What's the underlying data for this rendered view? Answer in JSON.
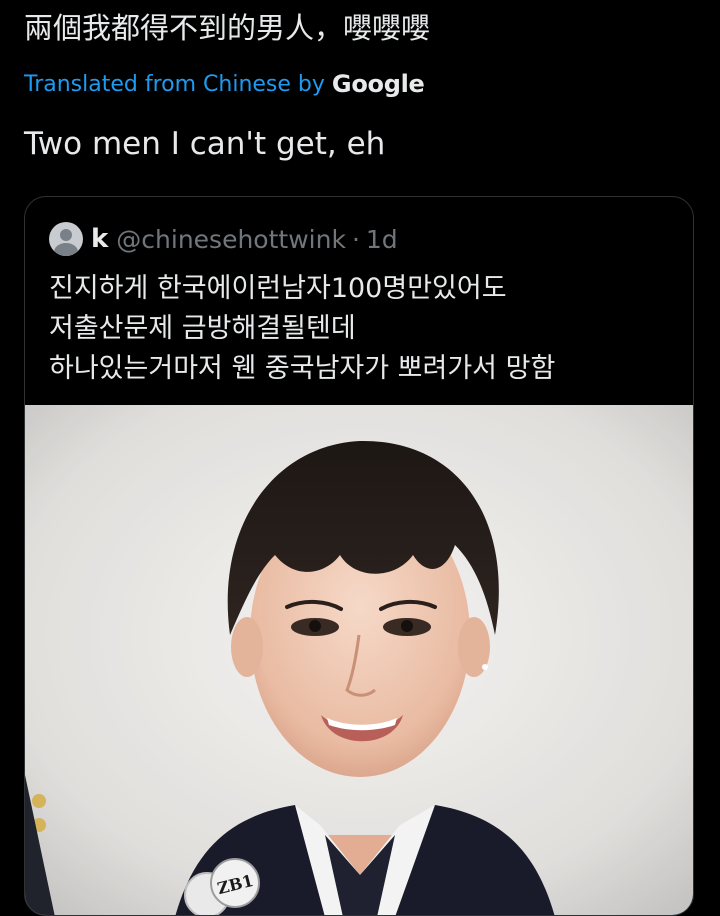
{
  "tweet": {
    "original_text": "兩個我都得不到的男人，嚶嚶嚶",
    "translated_label": "Translated from Chinese by",
    "translator_brand": "Google",
    "translated_text": "Two men I can't get, eh"
  },
  "quote": {
    "display_name": "k",
    "handle": "@chinesehottwink",
    "separator": "·",
    "time": "1d",
    "lines": [
      "진지하게 한국에이런남자100명만있어도",
      "저출산문제 금방해결될텐데",
      "하나있는거마저 웬 중국남자가 뽀려가서 망함"
    ],
    "media_badge_text": "ZB1"
  },
  "colors": {
    "background": "#000000",
    "text": "#e7e9ea",
    "link": "#1d9bf0",
    "muted": "#71767b",
    "border": "#2f3336"
  }
}
